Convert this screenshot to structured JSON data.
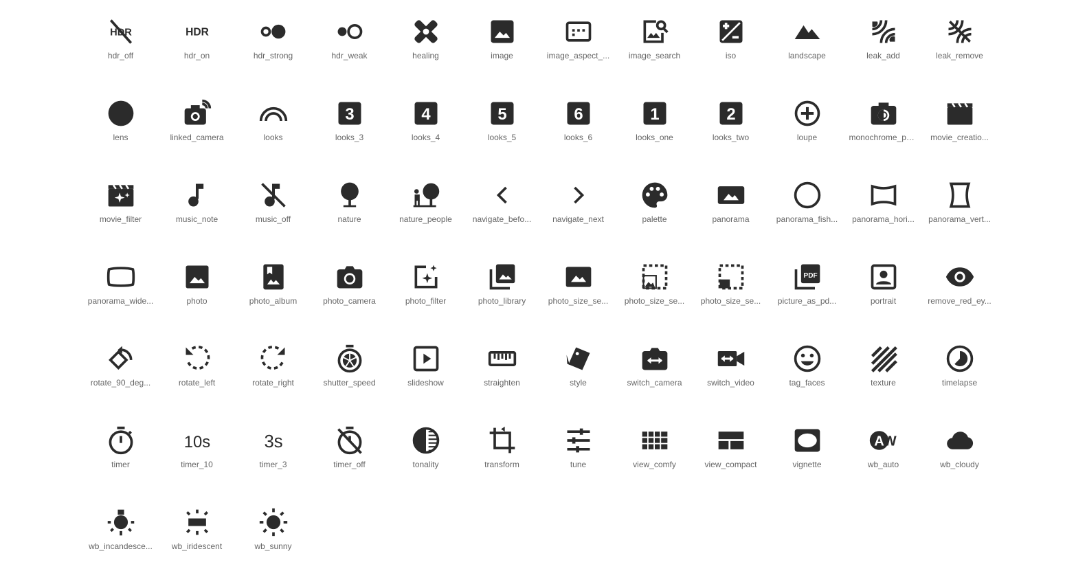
{
  "icon_color": "#2b2b2b",
  "label_color": "#666666",
  "icons": [
    {
      "name": "hdr_off-icon",
      "label": "hdr_off"
    },
    {
      "name": "hdr_on-icon",
      "label": "hdr_on"
    },
    {
      "name": "hdr_strong-icon",
      "label": "hdr_strong"
    },
    {
      "name": "hdr_weak-icon",
      "label": "hdr_weak"
    },
    {
      "name": "healing-icon",
      "label": "healing"
    },
    {
      "name": "image-icon",
      "label": "image"
    },
    {
      "name": "image_aspect_ratio-icon",
      "label": "image_aspect_..."
    },
    {
      "name": "image_search-icon",
      "label": "image_search"
    },
    {
      "name": "iso-icon",
      "label": "iso"
    },
    {
      "name": "landscape-icon",
      "label": "landscape"
    },
    {
      "name": "leak_add-icon",
      "label": "leak_add"
    },
    {
      "name": "leak_remove-icon",
      "label": "leak_remove"
    },
    {
      "name": "lens-icon",
      "label": "lens"
    },
    {
      "name": "linked_camera-icon",
      "label": "linked_camera"
    },
    {
      "name": "looks-icon",
      "label": "looks"
    },
    {
      "name": "looks_3-icon",
      "label": "looks_3",
      "glyph": "3"
    },
    {
      "name": "looks_4-icon",
      "label": "looks_4",
      "glyph": "4"
    },
    {
      "name": "looks_5-icon",
      "label": "looks_5",
      "glyph": "5"
    },
    {
      "name": "looks_6-icon",
      "label": "looks_6",
      "glyph": "6"
    },
    {
      "name": "looks_one-icon",
      "label": "looks_one",
      "glyph": "1"
    },
    {
      "name": "looks_two-icon",
      "label": "looks_two",
      "glyph": "2"
    },
    {
      "name": "loupe-icon",
      "label": "loupe"
    },
    {
      "name": "monochrome_photos-icon",
      "label": "monochrome_ph..."
    },
    {
      "name": "movie_creation-icon",
      "label": "movie_creatio..."
    },
    {
      "name": "movie_filter-icon",
      "label": "movie_filter"
    },
    {
      "name": "music_note-icon",
      "label": "music_note"
    },
    {
      "name": "music_off-icon",
      "label": "music_off"
    },
    {
      "name": "nature-icon",
      "label": "nature"
    },
    {
      "name": "nature_people-icon",
      "label": "nature_people"
    },
    {
      "name": "navigate_before-icon",
      "label": "navigate_befo..."
    },
    {
      "name": "navigate_next-icon",
      "label": "navigate_next"
    },
    {
      "name": "palette-icon",
      "label": "palette"
    },
    {
      "name": "panorama-icon",
      "label": "panorama"
    },
    {
      "name": "panorama_fish_eye-icon",
      "label": "panorama_fish..."
    },
    {
      "name": "panorama_horizontal-icon",
      "label": "panorama_hori..."
    },
    {
      "name": "panorama_vertical-icon",
      "label": "panorama_vert..."
    },
    {
      "name": "panorama_wide_angle-icon",
      "label": "panorama_wide..."
    },
    {
      "name": "photo-icon",
      "label": "photo"
    },
    {
      "name": "photo_album-icon",
      "label": "photo_album"
    },
    {
      "name": "photo_camera-icon",
      "label": "photo_camera"
    },
    {
      "name": "photo_filter-icon",
      "label": "photo_filter"
    },
    {
      "name": "photo_library-icon",
      "label": "photo_library"
    },
    {
      "name": "photo_size_select_actual-icon",
      "label": "photo_size_se..."
    },
    {
      "name": "photo_size_select_large-icon",
      "label": "photo_size_se..."
    },
    {
      "name": "photo_size_select_small-icon",
      "label": "photo_size_se..."
    },
    {
      "name": "picture_as_pdf-icon",
      "label": "picture_as_pd...",
      "glyph": "PDF"
    },
    {
      "name": "portrait-icon",
      "label": "portrait"
    },
    {
      "name": "remove_red_eye-icon",
      "label": "remove_red_ey..."
    },
    {
      "name": "rotate_90_degrees-icon",
      "label": "rotate_90_deg..."
    },
    {
      "name": "rotate_left-icon",
      "label": "rotate_left"
    },
    {
      "name": "rotate_right-icon",
      "label": "rotate_right"
    },
    {
      "name": "shutter_speed-icon",
      "label": "shutter_speed"
    },
    {
      "name": "slideshow-icon",
      "label": "slideshow"
    },
    {
      "name": "straighten-icon",
      "label": "straighten"
    },
    {
      "name": "style-icon",
      "label": "style"
    },
    {
      "name": "switch_camera-icon",
      "label": "switch_camera"
    },
    {
      "name": "switch_video-icon",
      "label": "switch_video"
    },
    {
      "name": "tag_faces-icon",
      "label": "tag_faces"
    },
    {
      "name": "texture-icon",
      "label": "texture"
    },
    {
      "name": "timelapse-icon",
      "label": "timelapse"
    },
    {
      "name": "timer-icon",
      "label": "timer"
    },
    {
      "name": "timer_10-icon",
      "label": "timer_10",
      "glyph": "10s"
    },
    {
      "name": "timer_3-icon",
      "label": "timer_3",
      "glyph": "3s"
    },
    {
      "name": "timer_off-icon",
      "label": "timer_off"
    },
    {
      "name": "tonality-icon",
      "label": "tonality"
    },
    {
      "name": "transform-icon",
      "label": "transform"
    },
    {
      "name": "tune-icon",
      "label": "tune"
    },
    {
      "name": "view_comfy-icon",
      "label": "view_comfy"
    },
    {
      "name": "view_compact-icon",
      "label": "view_compact"
    },
    {
      "name": "vignette-icon",
      "label": "vignette"
    },
    {
      "name": "wb_auto-icon",
      "label": "wb_auto",
      "glyph": "AW"
    },
    {
      "name": "wb_cloudy-icon",
      "label": "wb_cloudy"
    },
    {
      "name": "wb_incandescent-icon",
      "label": "wb_incandesce..."
    },
    {
      "name": "wb_iridescent-icon",
      "label": "wb_iridescent"
    },
    {
      "name": "wb_sunny-icon",
      "label": "wb_sunny"
    }
  ]
}
